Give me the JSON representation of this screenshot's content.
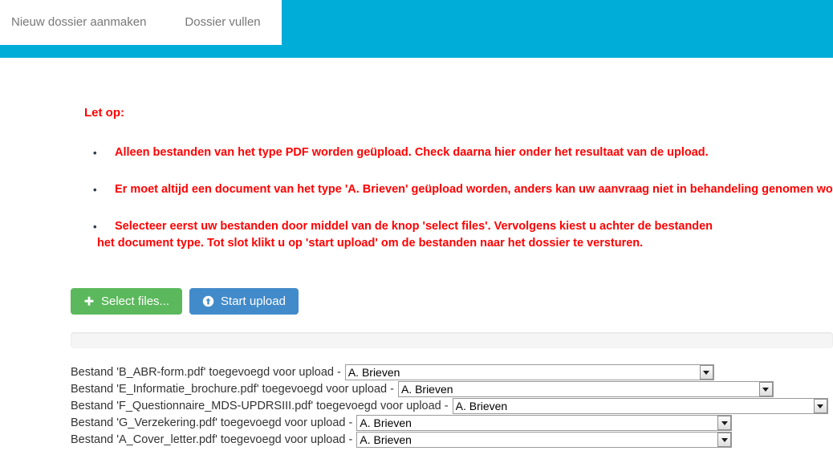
{
  "header": {
    "background_color": "#00ACD8",
    "tabs": [
      {
        "label": "Nieuw dossier aanmaken"
      },
      {
        "label": "Dossier vullen"
      }
    ]
  },
  "notice": {
    "title": "Let op:",
    "color": "#FF0000",
    "bullets": [
      {
        "text": "Alleen bestanden van het type PDF worden geüpload. Check daarna hier onder het resultaat van de upload."
      },
      {
        "text": "Er moet altijd een document van het type 'A. Brieven' geüpload worden, anders kan uw aanvraag niet in behandeling genomen worden"
      },
      {
        "line1": "Selecteer eerst uw bestanden door middel van de knop 'select files'. Vervolgens kiest u achter de bestanden",
        "line2": "het document type. Tot slot klikt u op 'start upload' om de bestanden naar het dossier te versturen."
      }
    ]
  },
  "toolbar": {
    "select_files_label": "Select files...",
    "select_files_icon": "plus-icon",
    "select_files_color": "#5CB85C",
    "start_upload_label": "Start upload",
    "start_upload_icon": "upload-circle-icon",
    "start_upload_color": "#428BCA"
  },
  "progress": {
    "percent": 0,
    "track_color": "#f5f5f5",
    "fill_color": "#5CB85C"
  },
  "files": [
    {
      "label": "Bestand 'B_ABR-form.pdf' toegevoegd voor upload -",
      "doc_type": "A. Brieven",
      "select_width": 460
    },
    {
      "label": "Bestand 'E_Informatie_brochure.pdf' toegevoegd voor upload -",
      "doc_type": "A. Brieven",
      "select_width": 468
    },
    {
      "label": "Bestand 'F_Questionnaire_MDS-UPDRSIII.pdf' toegevoegd voor upload -",
      "doc_type": "A. Brieven",
      "select_width": 468
    },
    {
      "label": "Bestand 'G_Verzekering.pdf' toegevoegd voor upload -",
      "doc_type": "A. Brieven",
      "select_width": 468
    },
    {
      "label": "Bestand 'A_Cover_letter.pdf' toegevoegd voor upload -",
      "doc_type": "A. Brieven",
      "select_width": 468
    }
  ]
}
